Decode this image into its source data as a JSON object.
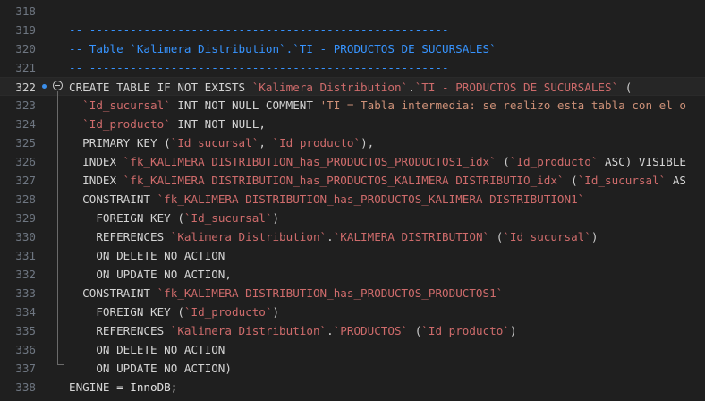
{
  "editor": {
    "lines": [
      {
        "num": "318",
        "tokens": []
      },
      {
        "num": "319",
        "tokens": [
          {
            "t": "comment",
            "v": "-- -----------------------------------------------------"
          }
        ]
      },
      {
        "num": "320",
        "tokens": [
          {
            "t": "comment",
            "v": "-- Table `Kalimera Distribution`.`TI - PRODUCTOS DE SUCURSALES`"
          }
        ]
      },
      {
        "num": "321",
        "tokens": [
          {
            "t": "comment",
            "v": "-- -----------------------------------------------------"
          }
        ]
      },
      {
        "num": "322",
        "tokens": [
          {
            "t": "keyword",
            "v": "CREATE TABLE IF NOT EXISTS "
          },
          {
            "t": "ident",
            "v": "`Kalimera Distribution`"
          },
          {
            "t": "plain",
            "v": "."
          },
          {
            "t": "ident",
            "v": "`TI - PRODUCTOS DE SUCURSALES`"
          },
          {
            "t": "plain",
            "v": " ("
          }
        ]
      },
      {
        "num": "323",
        "tokens": [
          {
            "t": "plain",
            "v": "  "
          },
          {
            "t": "ident",
            "v": "`Id_sucursal`"
          },
          {
            "t": "keyword",
            "v": " INT NOT NULL COMMENT "
          },
          {
            "t": "string",
            "v": "'TI = Tabla intermedia: se realizo esta tabla con el o"
          }
        ]
      },
      {
        "num": "324",
        "tokens": [
          {
            "t": "plain",
            "v": "  "
          },
          {
            "t": "ident",
            "v": "`Id_producto`"
          },
          {
            "t": "keyword",
            "v": " INT NOT NULL,"
          }
        ]
      },
      {
        "num": "325",
        "tokens": [
          {
            "t": "keyword",
            "v": "  PRIMARY KEY ("
          },
          {
            "t": "ident",
            "v": "`Id_sucursal`"
          },
          {
            "t": "plain",
            "v": ", "
          },
          {
            "t": "ident",
            "v": "`Id_producto`"
          },
          {
            "t": "plain",
            "v": "),"
          }
        ]
      },
      {
        "num": "326",
        "tokens": [
          {
            "t": "keyword",
            "v": "  INDEX "
          },
          {
            "t": "ident",
            "v": "`fk_KALIMERA DISTRIBUTION_has_PRODUCTOS_PRODUCTOS1_idx`"
          },
          {
            "t": "plain",
            "v": " ("
          },
          {
            "t": "ident",
            "v": "`Id_producto`"
          },
          {
            "t": "keyword",
            "v": " ASC) VISIBLE"
          }
        ]
      },
      {
        "num": "327",
        "tokens": [
          {
            "t": "keyword",
            "v": "  INDEX "
          },
          {
            "t": "ident",
            "v": "`fk_KALIMERA DISTRIBUTION_has_PRODUCTOS_KALIMERA DISTRIBUTIO_idx`"
          },
          {
            "t": "plain",
            "v": " ("
          },
          {
            "t": "ident",
            "v": "`Id_sucursal`"
          },
          {
            "t": "keyword",
            "v": " AS"
          }
        ]
      },
      {
        "num": "328",
        "tokens": [
          {
            "t": "keyword",
            "v": "  CONSTRAINT "
          },
          {
            "t": "ident",
            "v": "`fk_KALIMERA DISTRIBUTION_has_PRODUCTOS_KALIMERA DISTRIBUTION1`"
          }
        ]
      },
      {
        "num": "329",
        "tokens": [
          {
            "t": "keyword",
            "v": "    FOREIGN KEY ("
          },
          {
            "t": "ident",
            "v": "`Id_sucursal`"
          },
          {
            "t": "plain",
            "v": ")"
          }
        ]
      },
      {
        "num": "330",
        "tokens": [
          {
            "t": "keyword",
            "v": "    REFERENCES "
          },
          {
            "t": "ident",
            "v": "`Kalimera Distribution`"
          },
          {
            "t": "plain",
            "v": "."
          },
          {
            "t": "ident",
            "v": "`KALIMERA DISTRIBUTION`"
          },
          {
            "t": "plain",
            "v": " ("
          },
          {
            "t": "ident",
            "v": "`Id_sucursal`"
          },
          {
            "t": "plain",
            "v": ")"
          }
        ]
      },
      {
        "num": "331",
        "tokens": [
          {
            "t": "keyword",
            "v": "    ON DELETE NO ACTION"
          }
        ]
      },
      {
        "num": "332",
        "tokens": [
          {
            "t": "keyword",
            "v": "    ON UPDATE NO ACTION,"
          }
        ]
      },
      {
        "num": "333",
        "tokens": [
          {
            "t": "keyword",
            "v": "  CONSTRAINT "
          },
          {
            "t": "ident",
            "v": "`fk_KALIMERA DISTRIBUTION_has_PRODUCTOS_PRODUCTOS1`"
          }
        ]
      },
      {
        "num": "334",
        "tokens": [
          {
            "t": "keyword",
            "v": "    FOREIGN KEY ("
          },
          {
            "t": "ident",
            "v": "`Id_producto`"
          },
          {
            "t": "plain",
            "v": ")"
          }
        ]
      },
      {
        "num": "335",
        "tokens": [
          {
            "t": "keyword",
            "v": "    REFERENCES "
          },
          {
            "t": "ident",
            "v": "`Kalimera Distribution`"
          },
          {
            "t": "plain",
            "v": "."
          },
          {
            "t": "ident",
            "v": "`PRODUCTOS`"
          },
          {
            "t": "plain",
            "v": " ("
          },
          {
            "t": "ident",
            "v": "`Id_producto`"
          },
          {
            "t": "plain",
            "v": ")"
          }
        ]
      },
      {
        "num": "336",
        "tokens": [
          {
            "t": "keyword",
            "v": "    ON DELETE NO ACTION"
          }
        ]
      },
      {
        "num": "337",
        "tokens": [
          {
            "t": "keyword",
            "v": "    ON UPDATE NO ACTION)"
          }
        ]
      },
      {
        "num": "338",
        "tokens": [
          {
            "t": "keyword",
            "v": "ENGINE = "
          },
          {
            "t": "engine",
            "v": "InnoDB"
          },
          {
            "t": "plain",
            "v": ";"
          }
        ]
      }
    ],
    "active_line": "322",
    "colors": {
      "background": "#1f1f1f",
      "comment": "#3794ff",
      "identifier": "#ce6b6b",
      "string": "#ce9178",
      "keyword": "#d4d4d4"
    }
  }
}
